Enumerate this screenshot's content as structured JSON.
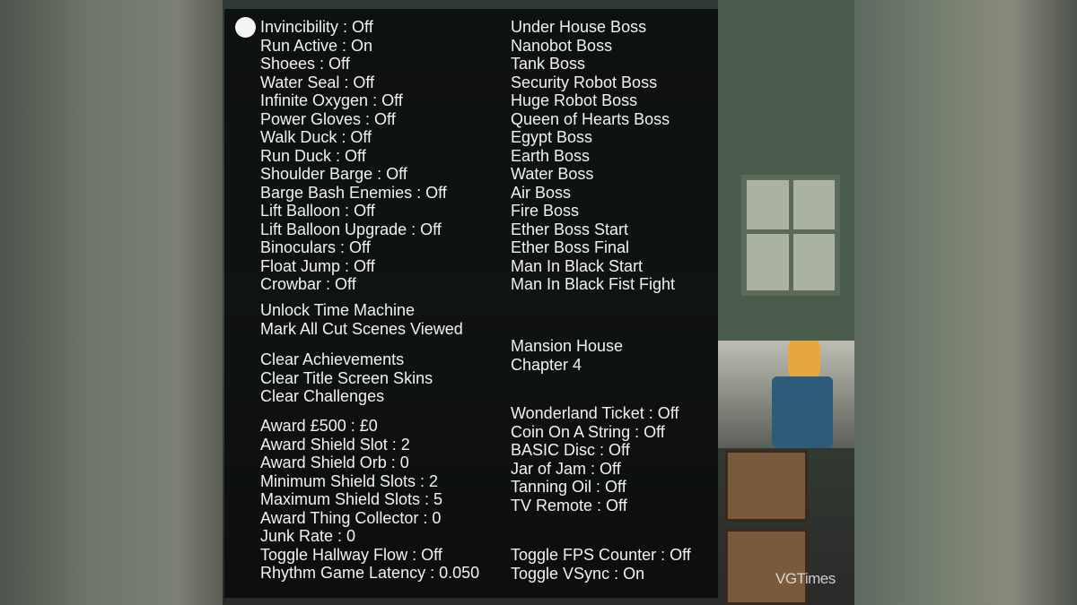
{
  "menu": {
    "selected_index": 0,
    "left_groups": [
      [
        "Invincibility : Off",
        "Run Active : On",
        "Shoees : Off",
        "Water Seal : Off",
        "Infinite Oxygen : Off",
        "Power Gloves : Off",
        "Walk Duck : Off",
        "Run Duck : Off",
        "Shoulder Barge : Off",
        "Barge Bash Enemies : Off",
        "Lift Balloon : Off",
        "Lift Balloon Upgrade : Off",
        "Binoculars : Off",
        "Float Jump : Off",
        "Crowbar : Off"
      ],
      [
        "Unlock Time Machine",
        "Mark All Cut Scenes Viewed"
      ],
      [
        "Clear Achievements",
        "Clear Title Screen Skins",
        "Clear Challenges"
      ],
      [
        "Award £500 : £0",
        "Award Shield Slot : 2",
        "Award Shield Orb : 0",
        "Minimum Shield Slots : 2",
        "Maximum Shield Slots : 5",
        "Award Thing Collector : 0",
        "Junk Rate : 0",
        "Toggle Hallway Flow : Off",
        "Rhythm Game Latency : 0.050"
      ]
    ],
    "right_groups": [
      [
        "Under House Boss",
        "Nanobot Boss",
        "Tank Boss",
        "Security Robot Boss",
        "Huge Robot Boss",
        "Queen of Hearts Boss",
        "Egypt Boss",
        "Earth Boss",
        "Water Boss",
        "Air Boss",
        "Fire Boss",
        "Ether Boss Start",
        "Ether Boss Final",
        "Man In Black Start",
        "Man In Black Fist Fight"
      ],
      [
        "Mansion House",
        "Chapter 4"
      ],
      [
        "Wonderland Ticket : Off",
        "Coin On A String : Off",
        "BASIC Disc : Off",
        "Jar of Jam : Off",
        "Tanning Oil : Off",
        "TV Remote : Off"
      ],
      [
        "Toggle FPS Counter : Off",
        "Toggle VSync : On"
      ]
    ]
  },
  "watermark": "VGTimes"
}
